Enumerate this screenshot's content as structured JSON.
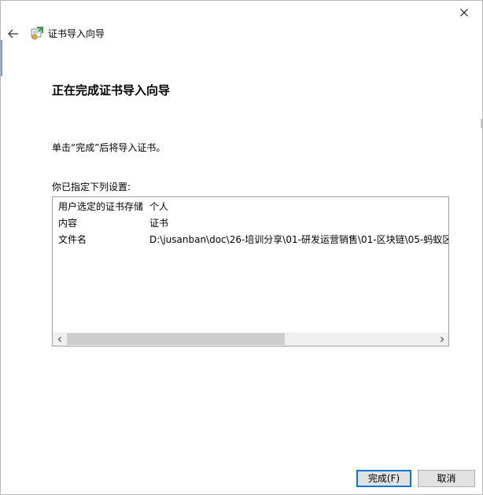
{
  "window": {
    "close_label": "✕",
    "title": "证书导入向导"
  },
  "page": {
    "heading": "正在完成证书导入向导",
    "instruction": "单击“完成”后将导入证书。",
    "settings_label": "你已指定下列设置:"
  },
  "settings": [
    {
      "key": "用户选定的证书存储",
      "value": "个人"
    },
    {
      "key": "内容",
      "value": "证书"
    },
    {
      "key": "文件名",
      "value": "D:\\jusanban\\doc\\26-培训分享\\01-研发运营销售\\01-区块链\\05-蚂蚁区"
    }
  ],
  "scrollbar": {
    "left_arrow": "<",
    "right_arrow": ">",
    "position": 0.0
  },
  "buttons": {
    "finish": "完成(F)",
    "cancel": "取消"
  },
  "colors": {
    "accent": "#0078d7",
    "button_bg": "#e1e1e1",
    "scrollbar_thumb": "#cdcdcd"
  }
}
